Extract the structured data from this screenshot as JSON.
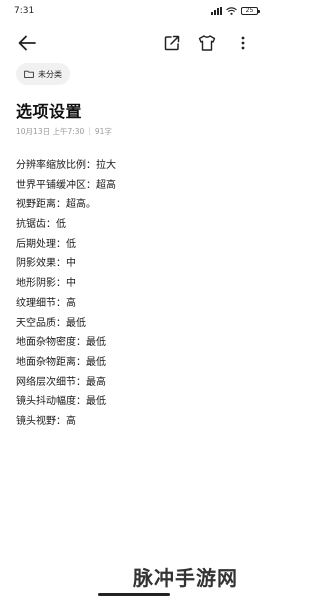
{
  "status_bar": {
    "time": "7:31",
    "battery": "25",
    "icons": [
      "signal-icon",
      "wifi-icon",
      "battery-icon"
    ]
  },
  "toolbar": {
    "icons": [
      "back-arrow-icon",
      "share-icon",
      "shirt-icon",
      "more-vertical-icon"
    ]
  },
  "note": {
    "category": "未分类",
    "title": "选项设置",
    "date": "10月13日 上午7:30",
    "separator": "|",
    "char_count": "91字",
    "lines": [
      "分辨率缩放比例：拉大",
      "世界平铺缓冲区：超高",
      "视野距离：超高。",
      "抗锯齿：低",
      "后期处理：低",
      "阴影效果：中",
      "地形阴影：中",
      "纹理细节：高",
      "天空品质：最低",
      "地面杂物密度：最低",
      "地面杂物距离：最低",
      "网络层次细节：最高",
      "镜头抖动幅度：最低",
      "镜头视野：高"
    ]
  },
  "watermark": "脉冲手游网",
  "colors": {
    "text": "#111111",
    "meta": "#9a9a9a",
    "chip_bg": "#f1f1f1"
  }
}
